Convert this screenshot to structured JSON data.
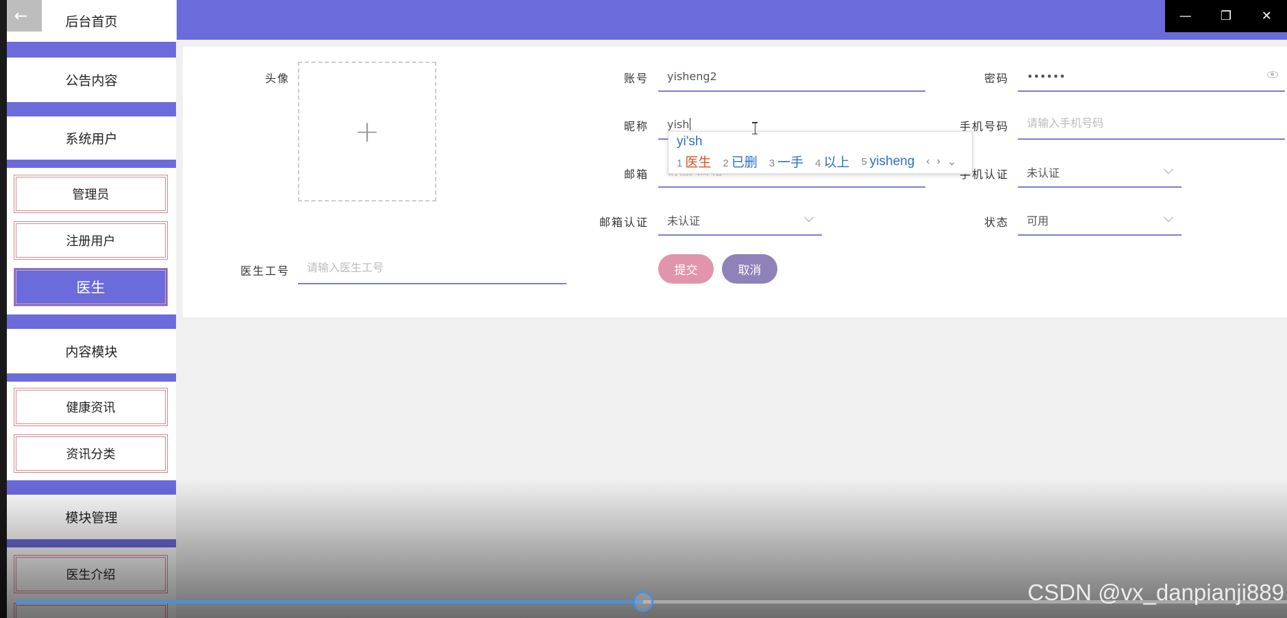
{
  "window_controls": {
    "minimize": "—",
    "restore": "❐",
    "close": "✕"
  },
  "sidebar": {
    "back_icon": "←",
    "menus": [
      {
        "label": "后台首页"
      },
      {
        "label": "公告内容"
      },
      {
        "label": "系统用户"
      },
      {
        "label": "内容模块"
      },
      {
        "label": "模块管理"
      }
    ],
    "sub_items": [
      {
        "label": "管理员"
      },
      {
        "label": "注册用户"
      },
      {
        "label": "医生"
      },
      {
        "label": "健康资讯"
      },
      {
        "label": "资讯分类"
      },
      {
        "label": "医生介绍"
      }
    ]
  },
  "form": {
    "avatar_label": "头像",
    "avatar_plus": "+",
    "account": {
      "label": "账号",
      "value": "yisheng2"
    },
    "password": {
      "label": "密码",
      "value": "••••••"
    },
    "nickname": {
      "label": "昵称",
      "value": "yish"
    },
    "phone": {
      "label": "手机号码",
      "placeholder": "请输入手机号码"
    },
    "email": {
      "label": "邮箱",
      "placeholder": "请输入邮箱"
    },
    "phone_verify": {
      "label": "手机认证",
      "value": "未认证"
    },
    "email_verify": {
      "label": "邮箱认证",
      "value": "未认证"
    },
    "status": {
      "label": "状态",
      "value": "可用"
    },
    "doctor_id": {
      "label": "医生工号",
      "placeholder": "请输入医生工号"
    },
    "submit_label": "提交",
    "cancel_label": "取消"
  },
  "ime": {
    "composition": "yi'sh",
    "candidates": [
      {
        "n": "1",
        "text": "医生"
      },
      {
        "n": "2",
        "text": "已删"
      },
      {
        "n": "3",
        "text": "一手"
      },
      {
        "n": "4",
        "text": "以上"
      },
      {
        "n": "5",
        "text": "yisheng"
      }
    ],
    "prev": "‹",
    "next": "›",
    "expand": "⌄"
  },
  "video": {
    "progress": 0.493,
    "watermark": "CSDN @vx_danpianji889"
  },
  "colors": {
    "accent": "#6b6bdc",
    "submit": "#e195ad",
    "cancel": "#8e82b8"
  }
}
